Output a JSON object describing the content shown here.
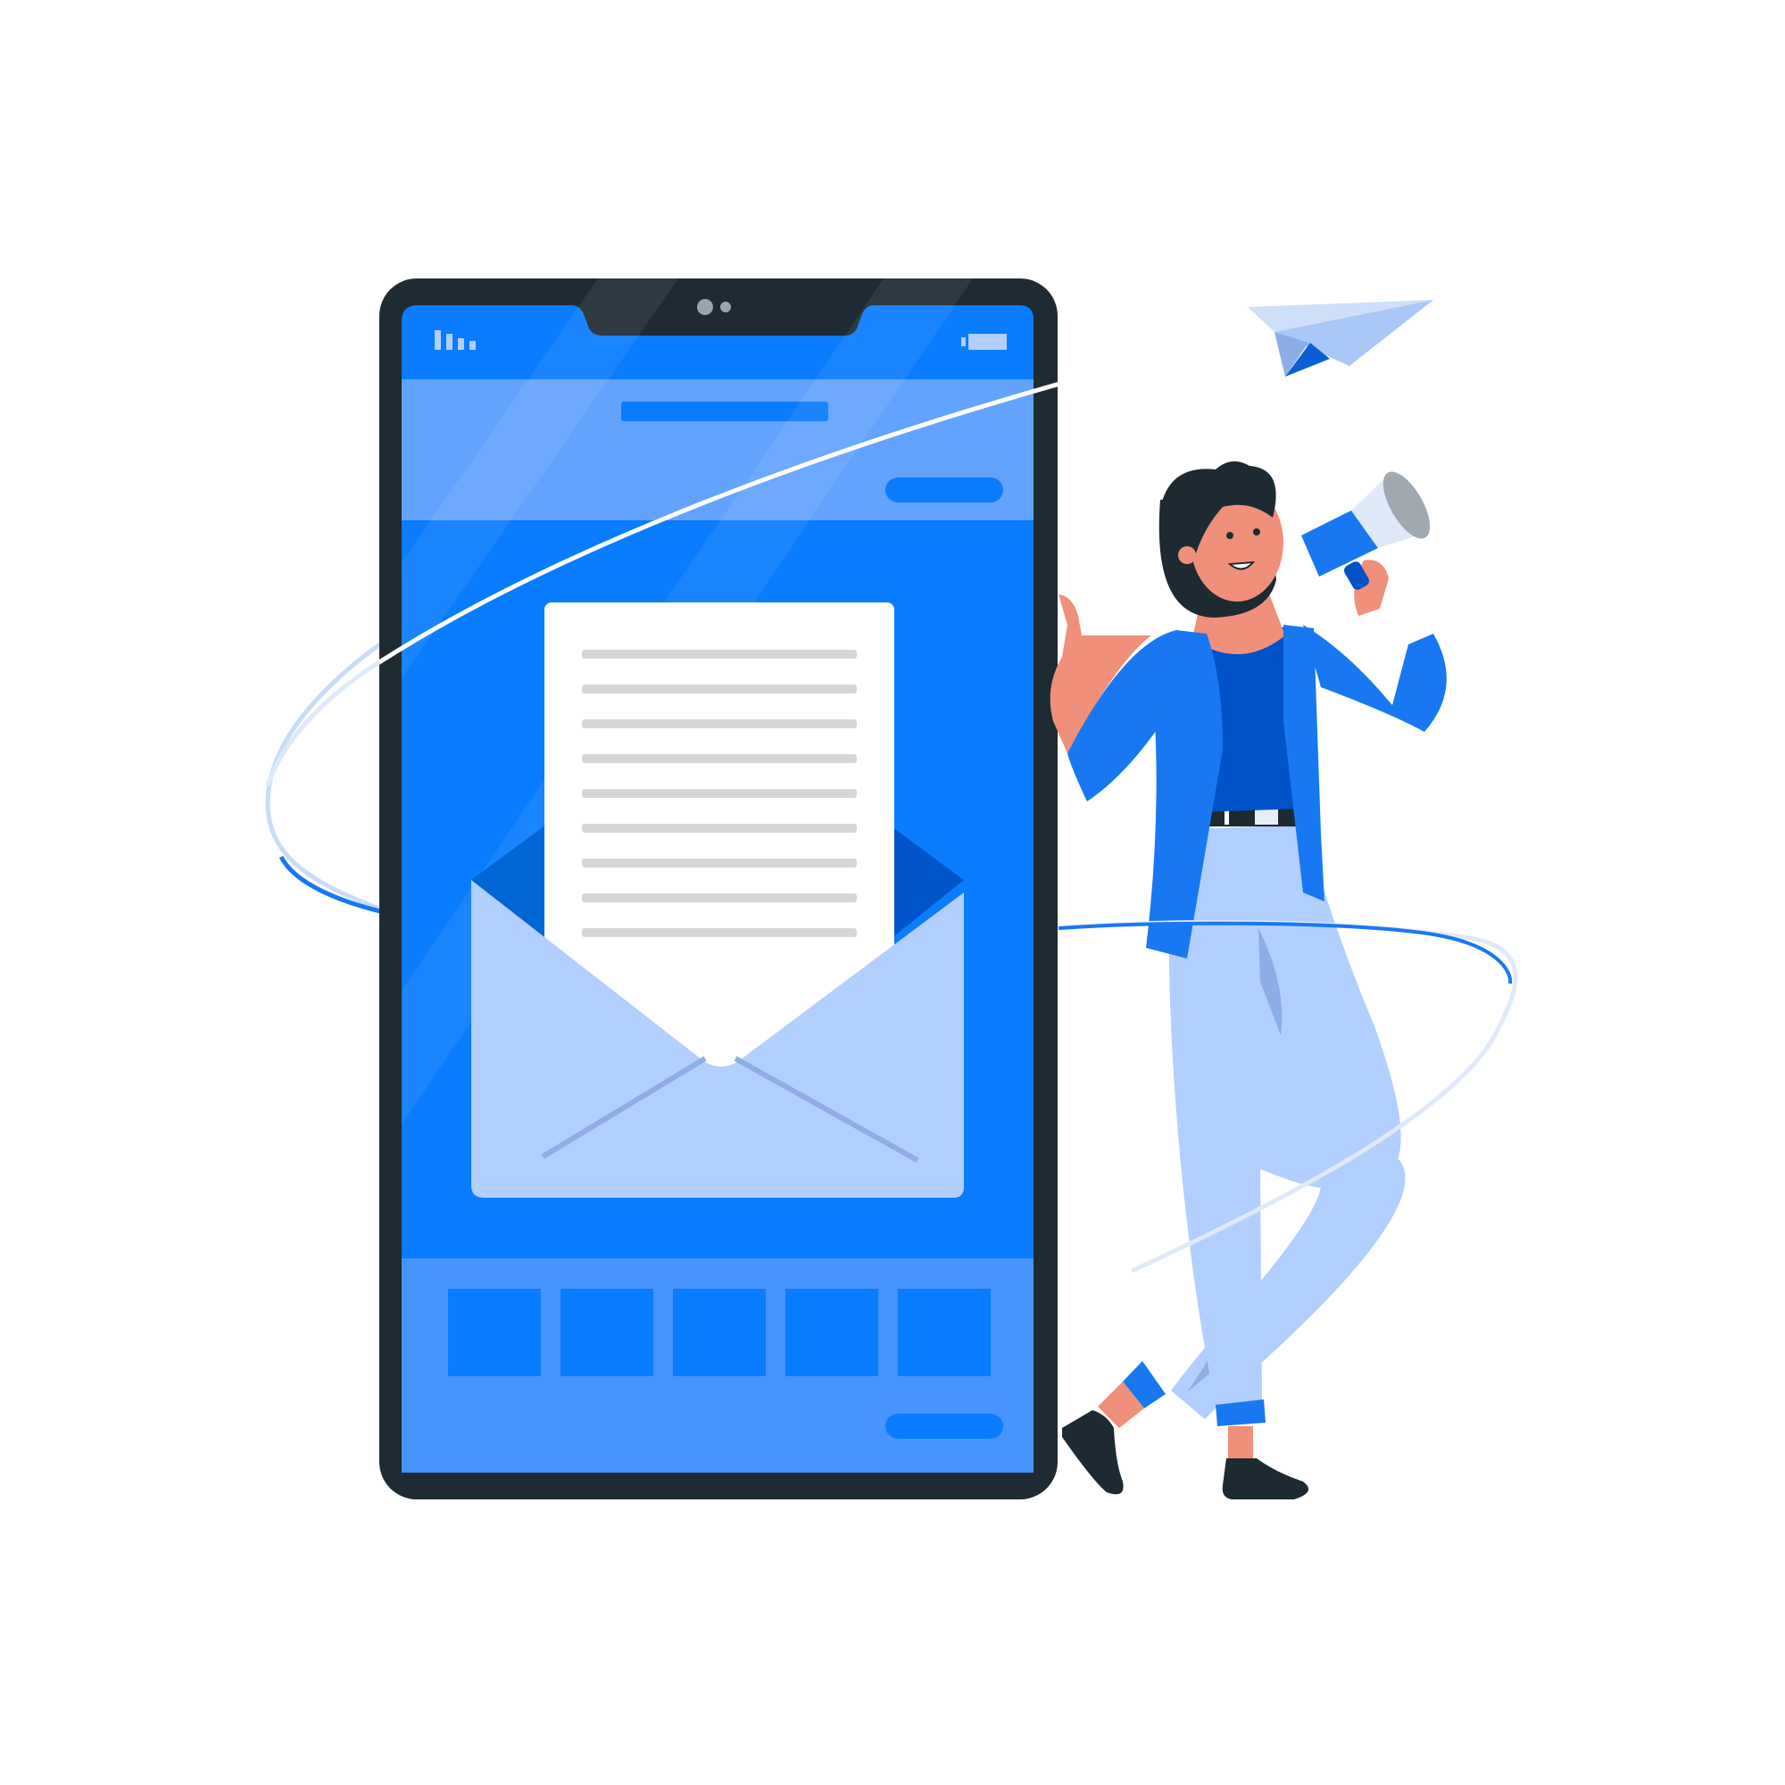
{
  "illustration": {
    "subject": "email-marketing",
    "icons": [
      "phone-icon",
      "envelope-icon",
      "letter-icon",
      "paper-plane-icon",
      "megaphone-icon"
    ]
  },
  "colors": {
    "background": "#ffffff",
    "phone_frame": "#1f2b33",
    "screen": "#0a7cff",
    "screen_light": "#4d96ff",
    "envelope": "#b1cfff",
    "envelope_dark": "#0057c9",
    "letter": "#ffffff",
    "letter_lines": "#d6d6d6",
    "paper_plane": "#a9c8f7",
    "skin": "#f0907a",
    "hair": "#1d2a32",
    "pants": "#b1cfff",
    "jacket": "#1878f2",
    "top": "#0052c8"
  },
  "phone": {
    "status_bar": {
      "signal_icon": "signal-bars-icon",
      "battery_icon": "battery-icon"
    },
    "footer_tile_count": 5,
    "letter_line_count": 9
  }
}
